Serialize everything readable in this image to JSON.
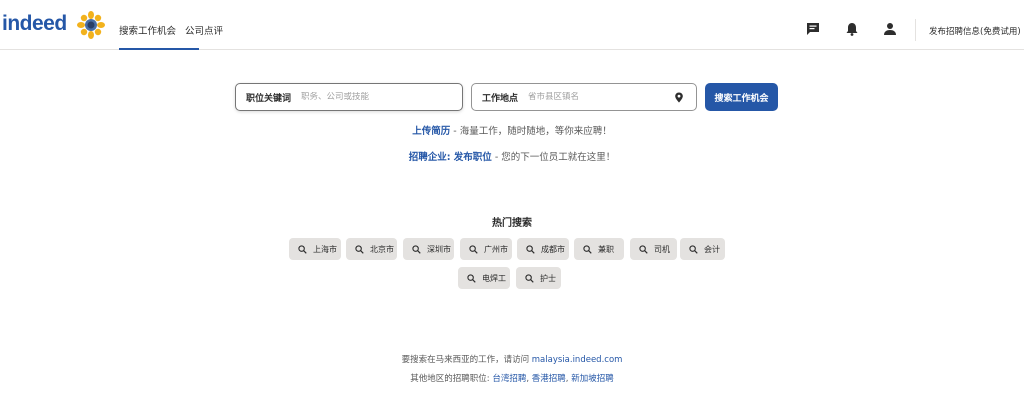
{
  "header": {
    "logo_text": "indeed",
    "tabs": [
      {
        "label": "搜索工作机会"
      },
      {
        "label": "公司点评"
      }
    ],
    "post_job_label": "发布招聘信息(免费试用)"
  },
  "search": {
    "what_label": "职位关键词",
    "what_placeholder": "职务、公司或技能",
    "where_label": "工作地点",
    "where_placeholder": "省市县区镇名",
    "button_label": "搜索工作机会"
  },
  "promo": {
    "resume_link": "上传简历",
    "resume_text": " - 海量工作，随时随地，等你来应聘！",
    "employer_link": "招聘企业: 发布职位",
    "employer_text": " - 您的下一位员工就在这里！"
  },
  "popular": {
    "title": "热门搜索",
    "chips": [
      "上海市",
      "北京市",
      "深圳市",
      "广州市",
      "成都市",
      "兼职",
      "司机",
      "会计",
      "电焊工",
      "护士"
    ]
  },
  "footer": {
    "line1_text": "要搜索在马来西亚的工作，请访问 ",
    "line1_link": "malaysia.indeed.com",
    "line2_text": "其他地区的招聘职位: ",
    "line2_links": [
      "台湾招聘",
      "香港招聘",
      "新加坡招聘"
    ]
  },
  "colors": {
    "brand": "#2557a7",
    "chip_bg": "#e4e2e0"
  },
  "icons": [
    "sunflower-icon",
    "message-icon",
    "bell-icon",
    "user-icon",
    "location-pin-icon",
    "search-icon"
  ]
}
